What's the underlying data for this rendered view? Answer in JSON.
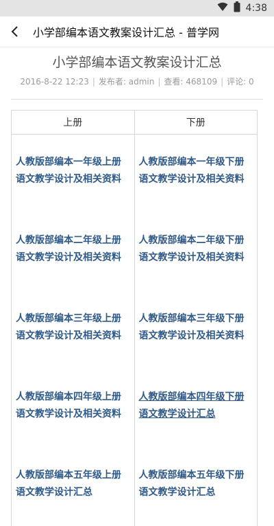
{
  "status_bar": {
    "time": "4:38",
    "icons": [
      "wifi-icon",
      "battery-icon"
    ]
  },
  "app_bar": {
    "title": "小学部编本语文教案设计汇总 - 普学网",
    "back_icon": "back-arrow-icon"
  },
  "article": {
    "title": "小学部编本语文教案设计汇总",
    "meta": {
      "date": "2016-8-22 12:23",
      "author": "发布者: admin",
      "views": "查看: 468109",
      "comments": "评论: 0"
    }
  },
  "table": {
    "headers": [
      "上册",
      "下册"
    ],
    "rows": [
      [
        "人教版部编本一年级上册语文教学设计及相关资料",
        "人教版部编本一年级下册语文教学设计及相关资料"
      ],
      [
        "人教版部编本二年级上册语文教学设计及相关资料",
        "人教版部编本二年级下册语文教学设计及相关资料"
      ],
      [
        "人教版部编本三年级上册语文教学设计及相关资料",
        "人教版部编本三年级下册语文教学设计及相关资料"
      ],
      [
        "人教版部编本四年级上册语文教学设计及相关资料",
        "人教版部编本四年级下册语文教学设计汇总"
      ],
      [
        "人教版部编本五年级上册语文教学设计汇总",
        "人教版部编本五年级下册语文教学设计汇总"
      ]
    ]
  },
  "colors": {
    "link": "#2f5a8a",
    "status_bar_bg": "#e4e4e4"
  }
}
